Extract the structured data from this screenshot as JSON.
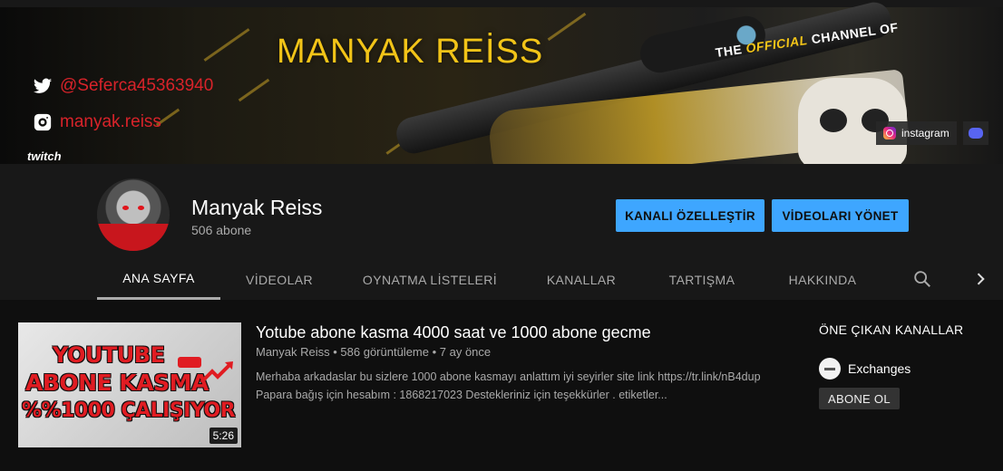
{
  "banner": {
    "title": "MANYAK REİSS",
    "tagline_prefix": "THE",
    "tagline_accent": "OFFICIAL",
    "tagline_suffix": "CHANNEL OF",
    "twitter_handle": "@Seferca45363940",
    "instagram_handle": "manyak.reiss",
    "twitch_label": "twitch",
    "links": [
      {
        "label": "instagram",
        "icon": "instagram-icon"
      },
      {
        "label": "",
        "icon": "discord-icon"
      }
    ]
  },
  "channel": {
    "name": "Manyak Reiss",
    "subscribers": "506 abone",
    "customize_label": "KANALI ÖZELLEŞTİR",
    "manage_label": "VİDEOLARI YÖNET"
  },
  "tabs": [
    {
      "label": "ANA SAYFA",
      "active": true
    },
    {
      "label": "VİDEOLAR",
      "active": false
    },
    {
      "label": "OYNATMA LİSTELERİ",
      "active": false
    },
    {
      "label": "KANALLAR",
      "active": false
    },
    {
      "label": "TARTIŞMA",
      "active": false
    },
    {
      "label": "HAKKINDA",
      "active": false
    }
  ],
  "video": {
    "thumbnail_lines": [
      "YOUTUBE",
      "ABONE KASMA",
      "%%1000 ÇALIŞIYOR"
    ],
    "duration": "5:26",
    "title": "Yotube abone kasma 4000 saat ve 1000 abone gecme",
    "meta": "Manyak Reiss • 586 görüntüleme • 7 ay önce",
    "description_line1": "Merhaba arkadaslar bu sizlere 1000 abone kasmayı anlattım iyi seyirler site link https://tr.link/nB4dup",
    "description_line2": "Papara bağış için hesabım : 1868217023 Destekleriniz için teşekkürler . etiketler..."
  },
  "featured": {
    "title": "ÖNE ÇIKAN KANALLAR",
    "channel_name": "Exchanges",
    "subscribe_label": "ABONE OL"
  },
  "colors": {
    "accent": "#3ea6ff",
    "banner_gold": "#f2c418",
    "banner_red": "#d8232a"
  }
}
